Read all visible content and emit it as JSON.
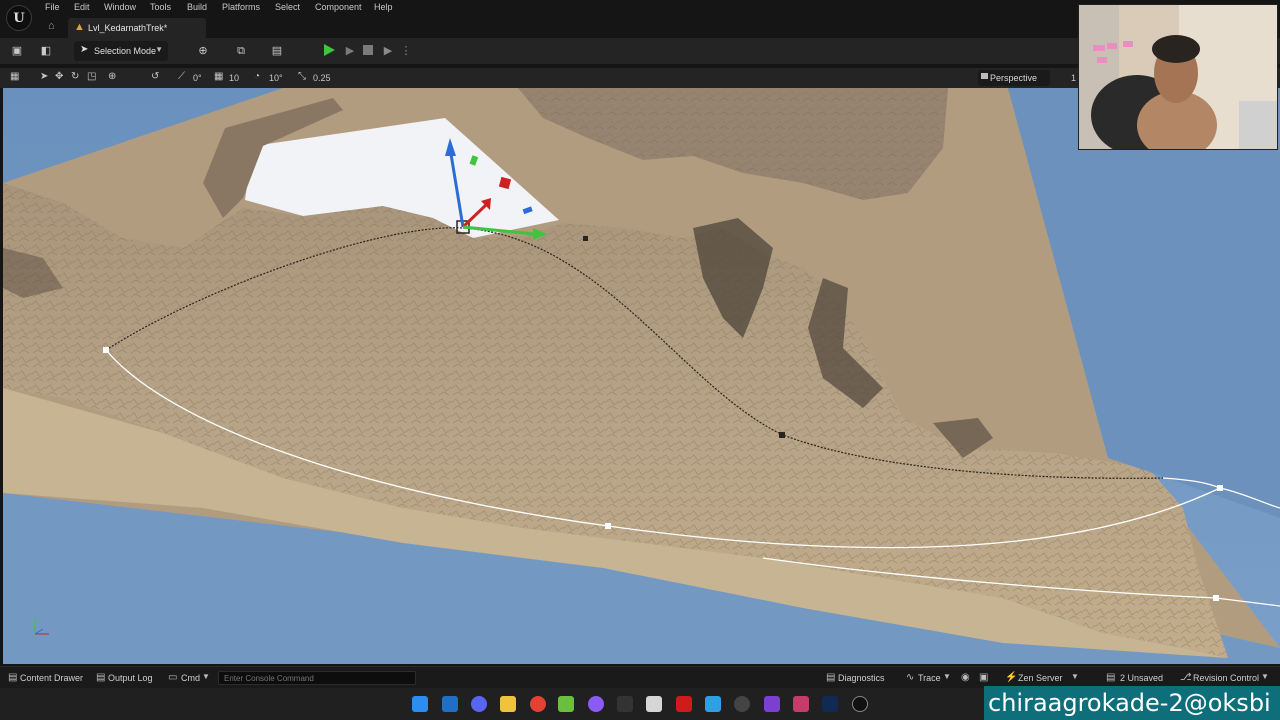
{
  "menu": {
    "items": [
      "File",
      "Edit",
      "Window",
      "Tools",
      "Build",
      "Platforms",
      "Select",
      "Component",
      "Help"
    ]
  },
  "tabs": {
    "level_tab_label": "Lvl_KedarnathTrek*"
  },
  "toolbar": {
    "selection_mode_label": "Selection Mode"
  },
  "viewport_toolbar": {
    "rotation_snap": "0°",
    "grid_snap": "10",
    "angle_snap": "10°",
    "scale_snap": "0.25",
    "view_mode": "Perspective",
    "extra": "1"
  },
  "statusbar": {
    "content_drawer": "Content Drawer",
    "output_log": "Output Log",
    "cmd": "Cmd",
    "console_placeholder": "Enter Console Command",
    "diagnostics": "Diagnostics",
    "trace": "Trace",
    "zen_server": "Zen Server",
    "unsaved": "2 Unsaved",
    "revision_control": "Revision Control"
  },
  "overlay": {
    "handle": "chiraagrokade-2@oksbi"
  },
  "colors": {
    "accent_play": "#3ec43e",
    "sky_blue": "#6e93bf",
    "terrain": "#b59e7f",
    "level_icon": "#e0a13b"
  }
}
